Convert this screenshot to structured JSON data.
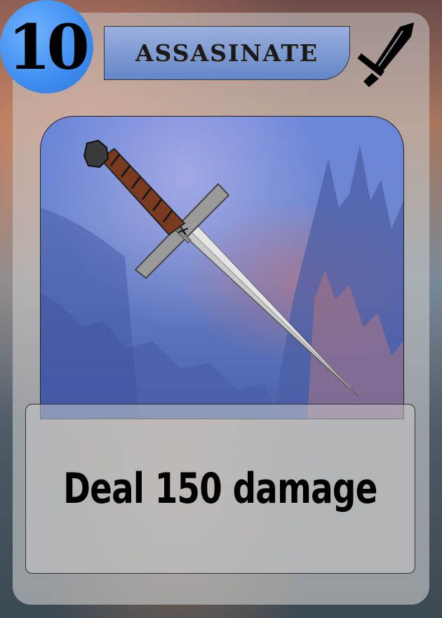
{
  "card": {
    "cost": "10",
    "name": "ASSASINATE",
    "type_icon": "sword-icon",
    "art": "dagger-illustration",
    "effect": "Deal 150 damage"
  },
  "colors": {
    "cost_badge": "#3d8cf0",
    "title_banner": "#7a9be0",
    "art_background": "#6a86d8"
  }
}
